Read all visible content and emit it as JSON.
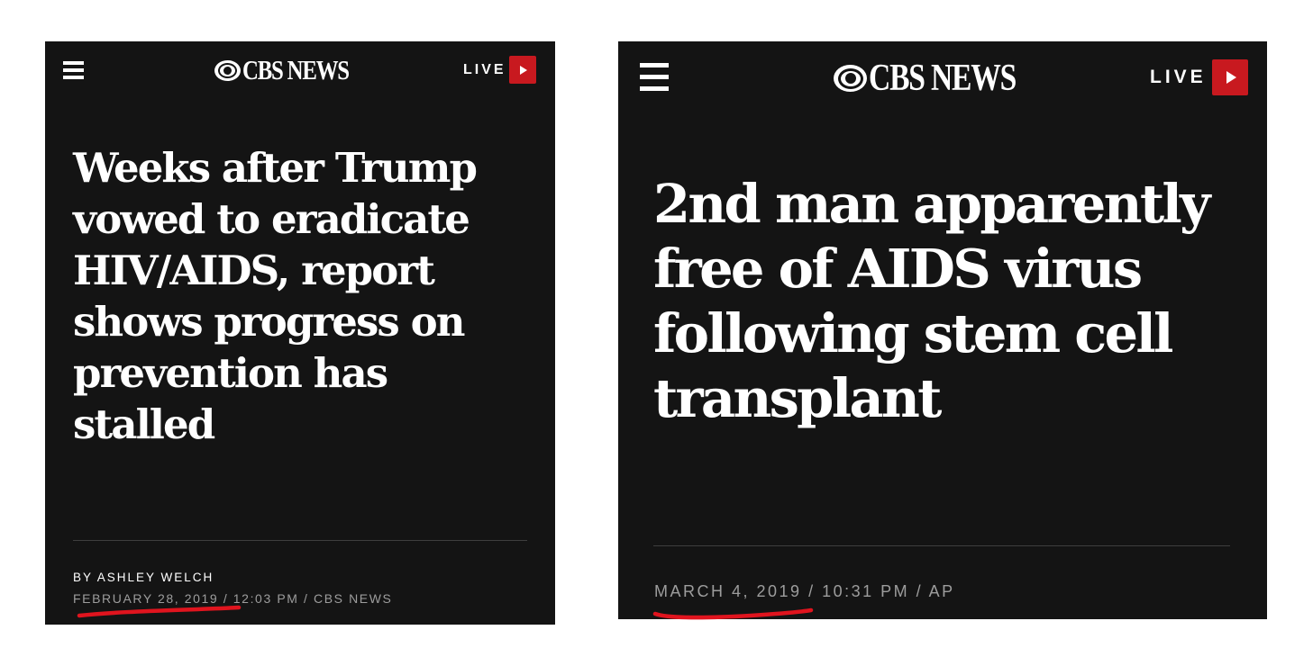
{
  "articles": [
    {
      "brand": "CBS NEWS",
      "live_label": "LIVE",
      "headline": "Weeks after Trump vowed to eradicate HIV/AIDS, report shows progress on prevention has stalled",
      "byline": "BY ASHLEY WELCH",
      "date": "FEBRUARY 28, 2019",
      "meta_rest": " / 12:03 PM / CBS NEWS"
    },
    {
      "brand": "CBS NEWS",
      "live_label": "LIVE",
      "headline": "2nd man apparently free of AIDS virus following stem cell transplant",
      "date": "MARCH 4, 2019",
      "meta_rest": " / 10:31 PM / AP"
    }
  ],
  "colors": {
    "panel_background": "#141414",
    "live_button": "#c8191f",
    "date_annotation": "#e0141e"
  }
}
